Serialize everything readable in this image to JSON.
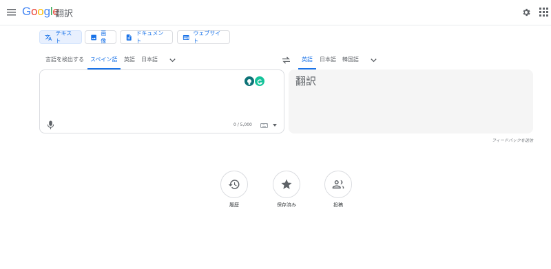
{
  "header": {
    "menu_icon": "hamburger-menu-icon",
    "logo_letters": [
      "G",
      "o",
      "o",
      "g",
      "l",
      "e"
    ],
    "product": "翻訳",
    "settings_icon": "gear-icon",
    "apps_icon": "apps-grid-icon"
  },
  "modes": [
    {
      "label": "テキスト",
      "icon": "translate-icon",
      "active": true
    },
    {
      "label": "画像",
      "icon": "image-icon",
      "active": false
    },
    {
      "label": "ドキュメント",
      "icon": "document-icon",
      "active": false
    },
    {
      "label": "ウェブサイト",
      "icon": "website-icon",
      "active": false
    }
  ],
  "source_langs": {
    "items": [
      "言語を検出する",
      "スペイン語",
      "英語",
      "日本語"
    ],
    "selected": "スペイン語"
  },
  "target_langs": {
    "items": [
      "英語",
      "日本語",
      "韓国語"
    ],
    "selected": "英語"
  },
  "source_panel": {
    "char_count": "0 / 5,000"
  },
  "target_panel": {
    "placeholder": "翻訳"
  },
  "feedback": "フィードバックを送信",
  "bottom_actions": [
    {
      "label": "履歴",
      "icon": "history-icon"
    },
    {
      "label": "保存済み",
      "icon": "star-icon"
    },
    {
      "label": "投稿",
      "icon": "community-icon"
    }
  ],
  "colors": {
    "accent": "#1a73e8",
    "target_bg": "#f5f5f5",
    "border": "#dadce0"
  }
}
